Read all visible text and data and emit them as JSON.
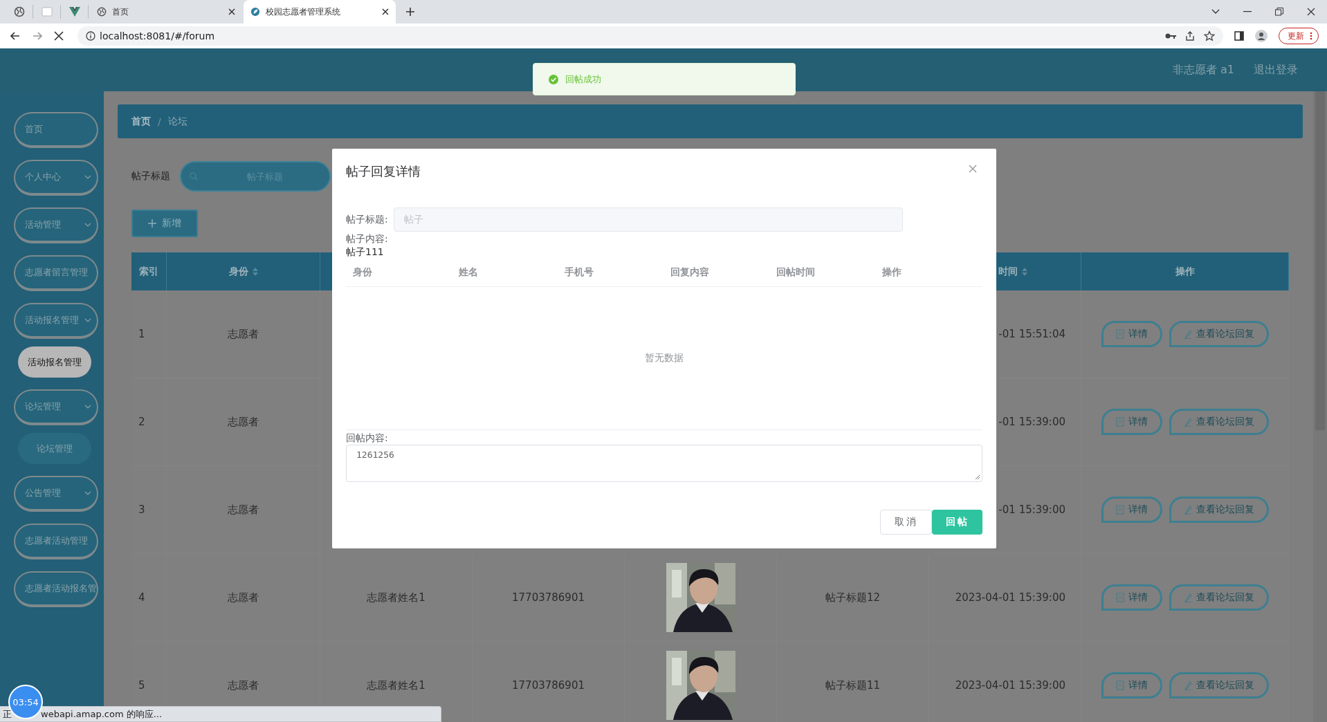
{
  "browser": {
    "tabs": [
      {
        "title": "首页",
        "selected": false
      },
      {
        "title": "校园志愿者管理系统",
        "selected": true
      }
    ],
    "url": "localhost:8081/#/forum",
    "update_button": "更新"
  },
  "header": {
    "user": "非志愿者 a1",
    "logout": "退出登录"
  },
  "toast": {
    "message": "回帖成功"
  },
  "sidebar": {
    "items": [
      {
        "label": "首页",
        "kind": "link"
      },
      {
        "label": "个人中心",
        "kind": "submenu"
      },
      {
        "label": "活动管理",
        "kind": "submenu"
      },
      {
        "label": "志愿者留言管理",
        "kind": "link"
      },
      {
        "label": "活动报名管理",
        "kind": "submenu",
        "children": [
          {
            "label": "活动报名管理",
            "selected": true
          }
        ]
      },
      {
        "label": "论坛管理",
        "kind": "submenu",
        "children": [
          {
            "label": "论坛管理",
            "selected": false
          }
        ]
      },
      {
        "label": "公告管理",
        "kind": "submenu"
      },
      {
        "label": "志愿者活动管理",
        "kind": "link"
      },
      {
        "label": "志愿者活动报名管",
        "kind": "link"
      }
    ]
  },
  "breadcrumb": {
    "items": [
      "首页",
      "论坛"
    ],
    "separator": "/"
  },
  "search": {
    "label": "帖子标题",
    "placeholder": "帖子标题"
  },
  "add_button": "新增",
  "table": {
    "columns": [
      {
        "kind": "index",
        "label": "索引",
        "sortable": false
      },
      {
        "kind": "identity",
        "label": "身份",
        "sortable": true
      },
      {
        "kind": "time",
        "label": "时间",
        "sortable": true
      },
      {
        "kind": "actions",
        "label": "操作",
        "sortable": false
      }
    ],
    "rows": [
      {
        "index": "1",
        "identity": "志愿者",
        "time": "-01 15:51:04",
        "actions": [
          "详情",
          "查看论坛回复"
        ]
      },
      {
        "index": "2",
        "identity": "志愿者",
        "time": "-01 15:39:00",
        "actions": [
          "详情",
          "查看论坛回复"
        ]
      },
      {
        "index": "3",
        "identity": "志愿者",
        "time": "-01 15:39:00",
        "actions": [
          "详情",
          "查看论坛回复"
        ]
      },
      {
        "index": "4",
        "identity": "志愿者",
        "name": "志愿者姓名1",
        "phone": "17703786901",
        "title": "帖子标题12",
        "time": "2023-04-01 15:39:00",
        "actions": [
          "详情",
          "查看论坛回复"
        ]
      },
      {
        "index": "5",
        "identity": "志愿者",
        "name": "志愿者姓名1",
        "phone": "17703786901",
        "title": "帖子标题11",
        "time": "2023-04-01 15:39:00",
        "actions": [
          "详情",
          "查看论坛回复"
        ]
      }
    ]
  },
  "dialog": {
    "title": "帖子回复详情",
    "title_field": {
      "label": "帖子标题:",
      "value": "帖子",
      "disabled": true
    },
    "content_label": "帖子内容:",
    "content": "帖子111",
    "replies": {
      "columns": [
        "身份",
        "姓名",
        "手机号",
        "回复内容",
        "回帖时间",
        "操作"
      ],
      "empty_text": "暂无数据"
    },
    "reply_label": "回帖内容:",
    "reply_value": "1261256",
    "cancel": "取消",
    "submit": "回帖"
  },
  "timer": "03:54",
  "status": {
    "leading": "正",
    "text": "webapi.amap.com 的响应..."
  }
}
